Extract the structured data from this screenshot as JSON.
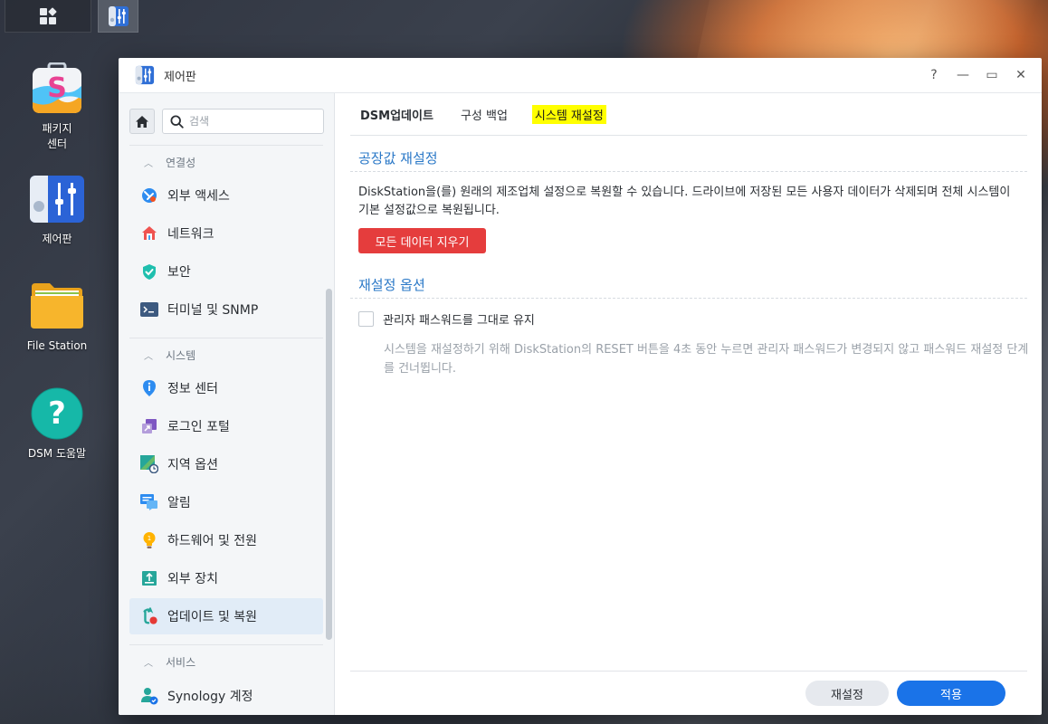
{
  "taskbar": {
    "main_icon": "grid-icon",
    "active_app_icon": "control-panel-icon"
  },
  "desktop": {
    "icons": [
      {
        "label": "패키지\n센터",
        "icon": "package-center-icon"
      },
      {
        "label": "제어판",
        "icon": "control-panel-icon"
      },
      {
        "label": "File Station",
        "icon": "folder-icon"
      },
      {
        "label": "DSM 도움말",
        "icon": "help-icon"
      }
    ]
  },
  "window": {
    "title": "제어판",
    "controls": {
      "help": "?",
      "minimize": "—",
      "maximize": "▭",
      "close": "✕"
    }
  },
  "sidebar": {
    "search_placeholder": "검색",
    "groups": [
      {
        "label": "연결성",
        "items": [
          "외부 액세스",
          "네트워크",
          "보안",
          "터미널 및 SNMP"
        ]
      },
      {
        "label": "시스템",
        "items": [
          "정보 센터",
          "로그인 포털",
          "지역 옵션",
          "알림",
          "하드웨어 및 전원",
          "외부 장치",
          "업데이트 및 복원"
        ]
      },
      {
        "label": "서비스",
        "items": [
          "Synology 계정"
        ]
      }
    ],
    "selected": "업데이트 및 복원"
  },
  "content": {
    "tabs": [
      "DSM업데이트",
      "구성 백업",
      "시스템 재설정"
    ],
    "active_tab": "시스템 재설정",
    "factory": {
      "title": "공장값 재설정",
      "description": "DiskStation을(를) 원래의 제조업체 설정으로 복원할 수 있습니다. 드라이브에 저장된 모든 사용자 데이터가 삭제되며 전체 시스템이 기본 설정값으로 복원됩니다.",
      "button": "모든 데이터 지우기"
    },
    "options": {
      "title": "재설정 옵션",
      "checkbox_label": "관리자 패스워드를 그대로 유지",
      "checked": false,
      "hint": "시스템을 재설정하기 위해 DiskStation의 RESET 버튼을 4초 동안 누르면 관리자 패스워드가 변경되지 않고 패스워드 재설정 단계를 건너뜁니다."
    },
    "footer": {
      "reset_button": "재설정",
      "apply_button": "적용"
    }
  },
  "colors": {
    "accent": "#1a73e8",
    "danger": "#e53d3d",
    "section_title": "#2a78c7",
    "tab_highlight": "#ffff00",
    "selected_item": "#e1ecf7"
  }
}
